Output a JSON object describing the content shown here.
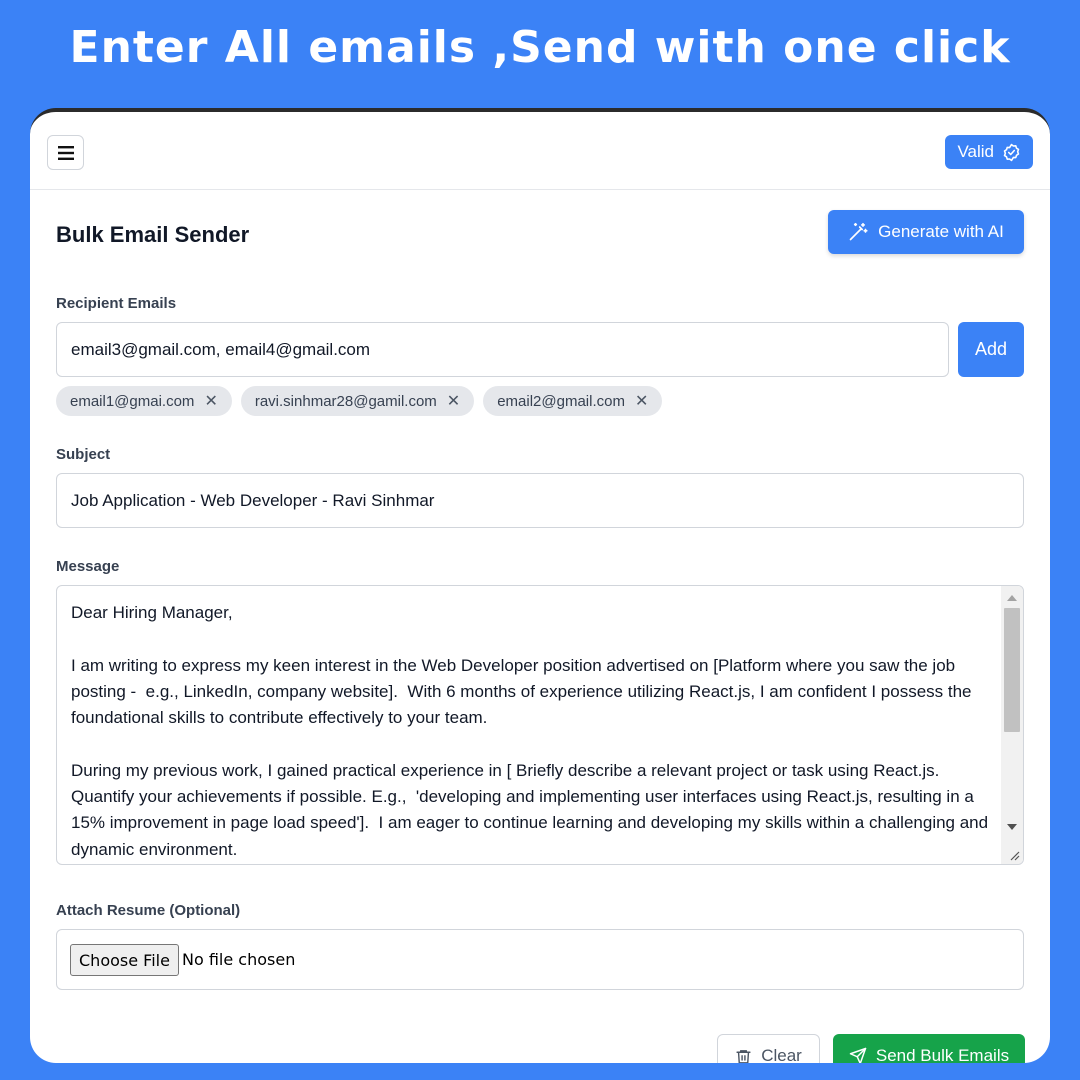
{
  "banner": {
    "headline": "Enter All emails ,Send with one click"
  },
  "topbar": {
    "menu_icon": "hamburger-menu-icon",
    "valid_label": "Valid",
    "valid_icon": "badge-check-icon"
  },
  "form": {
    "title": "Bulk Email Sender",
    "generate_label": "Generate with AI",
    "generate_icon": "magic-wand-icon",
    "recipients": {
      "label": "Recipient Emails",
      "input_value": "email3@gmail.com, email4@gmail.com",
      "add_label": "Add",
      "chips": [
        {
          "email": "email1@gmai.com"
        },
        {
          "email": "ravi.sinhmar28@gamil.com"
        },
        {
          "email": "email2@gmail.com"
        }
      ]
    },
    "subject": {
      "label": "Subject",
      "value": "Job Application - Web Developer - Ravi Sinhmar"
    },
    "message": {
      "label": "Message",
      "value": "Dear Hiring Manager,\n\nI am writing to express my keen interest in the Web Developer position advertised on [Platform where you saw the job posting -  e.g., LinkedIn, company website].  With 6 months of experience utilizing React.js, I am confident I possess the foundational skills to contribute effectively to your team.\n\nDuring my previous work, I gained practical experience in [ Briefly describe a relevant project or task using React.js. Quantify your achievements if possible. E.g.,  'developing and implementing user interfaces using React.js, resulting in a 15% improvement in page load speed'].  I am eager to continue learning and developing my skills within a challenging and dynamic environment."
    },
    "attachment": {
      "label": "Attach Resume (Optional)",
      "choose_label": "Choose File",
      "status": "No file chosen"
    },
    "actions": {
      "clear_label": "Clear",
      "clear_icon": "trash-icon",
      "send_label": "Send Bulk Emails",
      "send_icon": "send-icon"
    }
  },
  "colors": {
    "background": "#3b82f6",
    "primary": "#3b82f6",
    "send": "#16a34a",
    "chip": "#e5e7eb"
  }
}
